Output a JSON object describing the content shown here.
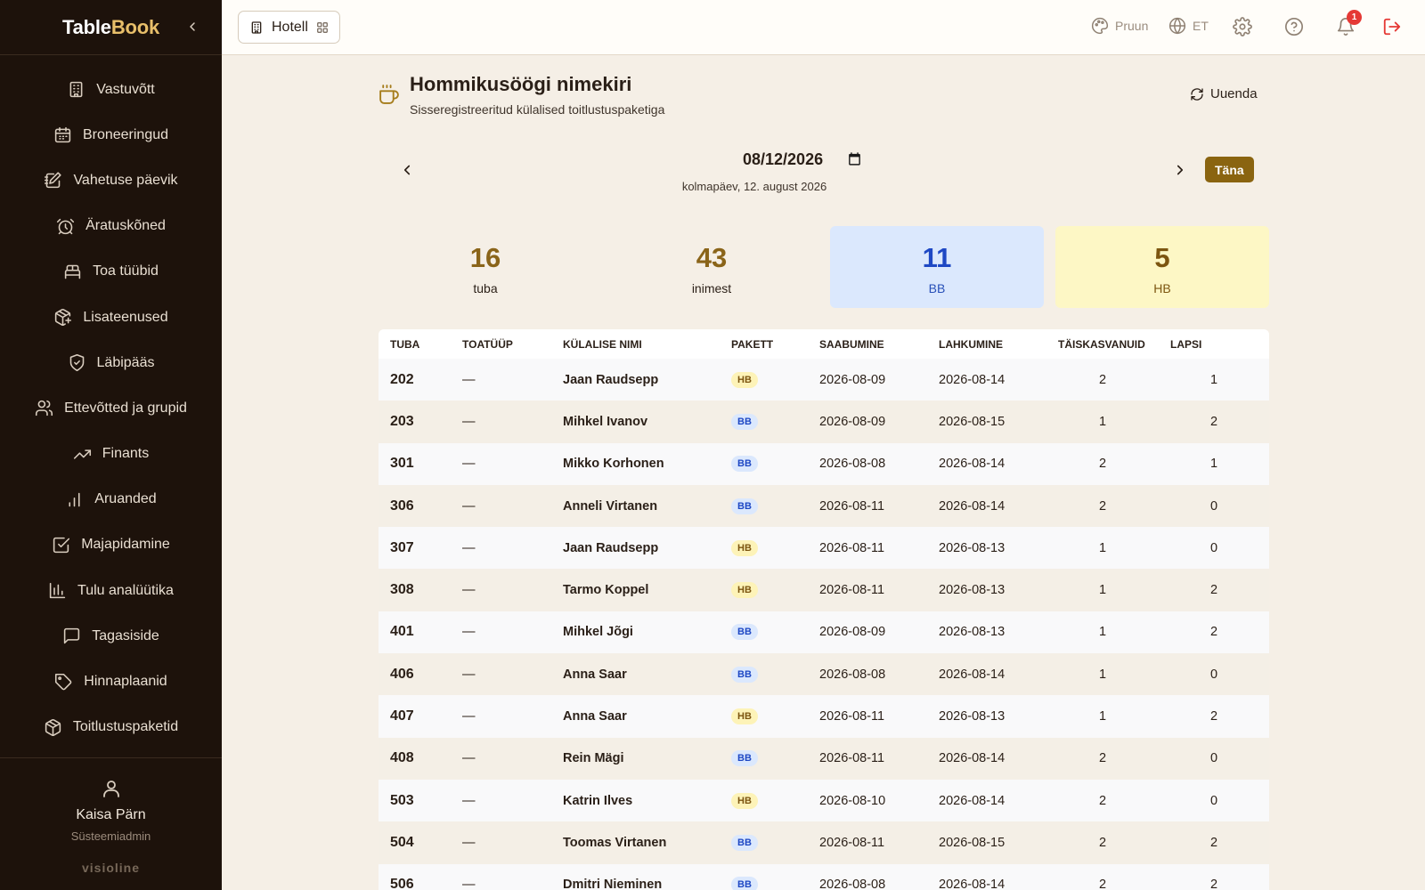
{
  "brand": {
    "part1": "Table",
    "part2": "Book"
  },
  "sidebar": {
    "items": [
      {
        "label": "Vastuvõtt",
        "icon": "building-icon"
      },
      {
        "label": "Broneeringud",
        "icon": "calendar-icon"
      },
      {
        "label": "Vahetuse päevik",
        "icon": "notebook-edit-icon"
      },
      {
        "label": "Äratuskõned",
        "icon": "alarm-clock-icon"
      },
      {
        "label": "Toa tüübid",
        "icon": "bed-icon"
      },
      {
        "label": "Lisateenused",
        "icon": "package-plus-icon"
      },
      {
        "label": "Läbipääs",
        "icon": "shield-check-icon"
      },
      {
        "label": "Ettevõtted ja grupid",
        "icon": "users-icon"
      },
      {
        "label": "Finants",
        "icon": "trending-up-icon"
      },
      {
        "label": "Aruanded",
        "icon": "bar-chart-icon"
      },
      {
        "label": "Majapidamine",
        "icon": "checkbox-icon"
      },
      {
        "label": "Tulu analüütika",
        "icon": "chart-icon"
      },
      {
        "label": "Tagasiside",
        "icon": "message-icon"
      },
      {
        "label": "Hinnaplaanid",
        "icon": "tag-icon"
      },
      {
        "label": "Toitlustuspaketid",
        "icon": "box-icon"
      }
    ],
    "user": {
      "name": "Kaisa Pärn",
      "role": "Süsteemiadmin"
    },
    "vendor": "visioline"
  },
  "topbar": {
    "hotel_label": "Hotell",
    "theme_label": "Pruun",
    "language_label": "ET",
    "notification_count": "1"
  },
  "page": {
    "title": "Hommikusöögi nimekiri",
    "subtitle": "Sisseregistreeritud külalised toitlustuspaketiga",
    "refresh_label": "Uuenda",
    "date_value": "08/12/2026",
    "date_long": "kolmapäev, 12. august 2026",
    "today_label": "Täna"
  },
  "stats": [
    {
      "value": "16",
      "label": "tuba"
    },
    {
      "value": "43",
      "label": "inimest"
    },
    {
      "value": "11",
      "label": "BB"
    },
    {
      "value": "5",
      "label": "HB"
    }
  ],
  "table": {
    "headers": [
      "Tuba",
      "Toatüüp",
      "Külalise nimi",
      "Pakett",
      "Saabumine",
      "Lahkumine",
      "Täiskasvanuid",
      "Lapsi"
    ],
    "rows": [
      {
        "room": "202",
        "type": "—",
        "guest": "Jaan Raudsepp",
        "package": "HB",
        "arrival": "2026-08-09",
        "departure": "2026-08-14",
        "adults": "2",
        "children": "1"
      },
      {
        "room": "203",
        "type": "—",
        "guest": "Mihkel Ivanov",
        "package": "BB",
        "arrival": "2026-08-09",
        "departure": "2026-08-15",
        "adults": "1",
        "children": "2"
      },
      {
        "room": "301",
        "type": "—",
        "guest": "Mikko Korhonen",
        "package": "BB",
        "arrival": "2026-08-08",
        "departure": "2026-08-14",
        "adults": "2",
        "children": "1"
      },
      {
        "room": "306",
        "type": "—",
        "guest": "Anneli Virtanen",
        "package": "BB",
        "arrival": "2026-08-11",
        "departure": "2026-08-14",
        "adults": "2",
        "children": "0"
      },
      {
        "room": "307",
        "type": "—",
        "guest": "Jaan Raudsepp",
        "package": "HB",
        "arrival": "2026-08-11",
        "departure": "2026-08-13",
        "adults": "1",
        "children": "0"
      },
      {
        "room": "308",
        "type": "—",
        "guest": "Tarmo Koppel",
        "package": "HB",
        "arrival": "2026-08-11",
        "departure": "2026-08-13",
        "adults": "1",
        "children": "2"
      },
      {
        "room": "401",
        "type": "—",
        "guest": "Mihkel Jõgi",
        "package": "BB",
        "arrival": "2026-08-09",
        "departure": "2026-08-13",
        "adults": "1",
        "children": "2"
      },
      {
        "room": "406",
        "type": "—",
        "guest": "Anna Saar",
        "package": "BB",
        "arrival": "2026-08-08",
        "departure": "2026-08-14",
        "adults": "1",
        "children": "0"
      },
      {
        "room": "407",
        "type": "—",
        "guest": "Anna Saar",
        "package": "HB",
        "arrival": "2026-08-11",
        "departure": "2026-08-13",
        "adults": "1",
        "children": "2"
      },
      {
        "room": "408",
        "type": "—",
        "guest": "Rein Mägi",
        "package": "BB",
        "arrival": "2026-08-11",
        "departure": "2026-08-14",
        "adults": "2",
        "children": "0"
      },
      {
        "room": "503",
        "type": "—",
        "guest": "Katrin Ilves",
        "package": "HB",
        "arrival": "2026-08-10",
        "departure": "2026-08-14",
        "adults": "2",
        "children": "0"
      },
      {
        "room": "504",
        "type": "—",
        "guest": "Toomas Virtanen",
        "package": "BB",
        "arrival": "2026-08-11",
        "departure": "2026-08-15",
        "adults": "2",
        "children": "2"
      },
      {
        "room": "506",
        "type": "—",
        "guest": "Dmitri Nieminen",
        "package": "BB",
        "arrival": "2026-08-08",
        "departure": "2026-08-14",
        "adults": "2",
        "children": "2"
      }
    ]
  },
  "colors": {
    "sidebar_bg": "#1d120b",
    "accent": "#8a6410",
    "bb": "#1e48c4",
    "hb": "#7c5510",
    "logout": "#e53935"
  }
}
